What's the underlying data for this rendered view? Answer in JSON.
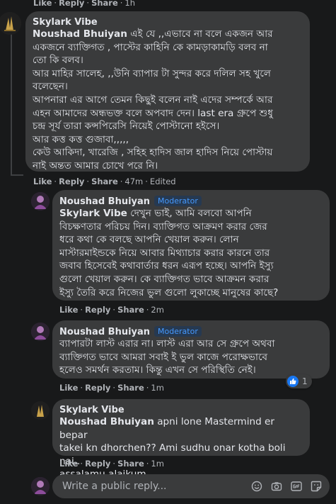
{
  "top_bar": {
    "like": "Like",
    "reply": "Reply",
    "share": "Share",
    "time": "1h"
  },
  "comments": [
    {
      "author": "Skylark Vibe",
      "lines": [
        {
          "mention": "Noushad Bhuiyan",
          "text": " এই যে ,,এভাবে না বলে একজন আর"
        },
        {
          "text": "একজনে ব্যাক্তিগত , পাস্টের কাহিনি কে কামড়াকামড়ি বলব না"
        },
        {
          "text": "তো কি বলব।"
        },
        {
          "text": "আর মাহির সালেহ, ,,উনি ব্যাপার টা সুন্দর করে দলিল সহ খুলে"
        },
        {
          "text": "বলেছেন।"
        },
        {
          "text": "আপনারা এর আগে তেমন কিছুই বলেন নাই এদের সম্পর্কে আর"
        },
        {
          "text": "এহন আমাদের অন্ধভক্ত বলে অপবাদ দেন। last era গ্রুপে শুধু"
        },
        {
          "text": "চন্দ্র সূর্য তারা কন্সপিরেসি নিয়েই পোস্টানো হইসে।"
        },
        {
          "text": "আর কত্ত কত্ত গুজাবা,,,,,"
        },
        {
          "text": "কেউ আকিদা, খারেজি , সহিহ হাদিস জাল হাদিস নিয়ে পোস্টায়"
        },
        {
          "text": "নাই অন্তত আমার চোখে পরে নি।"
        }
      ],
      "actions": {
        "like": "Like",
        "reply": "Reply",
        "share": "Share",
        "time": "47m",
        "edited": "Edited"
      }
    },
    {
      "author": "Noushad Bhuiyan",
      "badge": "Moderator",
      "lines": [
        {
          "mention": "Skylark Vibe",
          "text": " দেখুন ভাই, আমি বলবো আপনি"
        },
        {
          "text": "বিচক্ষণতার পরিচয় দিন। ব্যাক্তিগত আক্রমণ করার জের"
        },
        {
          "text": "ধরে কথা কে বলছে আপনি খেয়াল করুন। লোন"
        },
        {
          "text": "মাস্টারমাইন্ডকে নিয়ে আবার মিথ্যাচার করার কারনে তার"
        },
        {
          "text": "জবাব হিসেবেই কথাবার্তার ধরন এরূপ হচ্ছে। আপনি ইস্যু"
        },
        {
          "text": "গুলো খেয়াল করুন। কে ব্যাক্তিগত ভাবে আক্রমন করার"
        },
        {
          "text": "ইস্যু তৈরি করে নিজের ভুল গুলো লুকাচ্ছে মানুষের কাছে?"
        }
      ],
      "actions": {
        "like": "Like",
        "reply": "Reply",
        "share": "Share",
        "time": "2m"
      }
    },
    {
      "author": "Noushad Bhuiyan",
      "badge": "Moderator",
      "lines": [
        {
          "text": "ব্যাপারটা লাস্ট এরার না। লাস্ট এরা আর সে গ্রুপে অথবা"
        },
        {
          "text": "ব্যাক্তিগত ভাবে আমরা সবাই ই ভুল কাজে পরোক্ষভাবে"
        },
        {
          "text": "হলেও সমর্থন করতাম। কিন্তু এখন সে পরিস্থিতি নেই।"
        }
      ],
      "actions": {
        "like": "Like",
        "reply": "Reply",
        "share": "Share",
        "time": "1m"
      },
      "reaction": {
        "icon": "like-icon",
        "count": "1"
      }
    },
    {
      "author": "Skylark Vibe",
      "lines": [
        {
          "mention": "Noushad Bhuiyan",
          "text": " apni lone Mastermind er bepar"
        },
        {
          "text": "takei kn dhorchen?? Ami sudhu onar kotha boli nai.."
        },
        {
          "text": "assalamu alaikum"
        }
      ],
      "actions": {
        "like": "Like",
        "reply": "Reply",
        "share": "Share",
        "time": "1m"
      }
    }
  ],
  "composer": {
    "placeholder": "Write a public reply..."
  },
  "colors": {
    "background": "#18191a",
    "bubble": "#3a3b3c",
    "badge_text": "#4599ff",
    "muted": "#b0b3b8"
  }
}
